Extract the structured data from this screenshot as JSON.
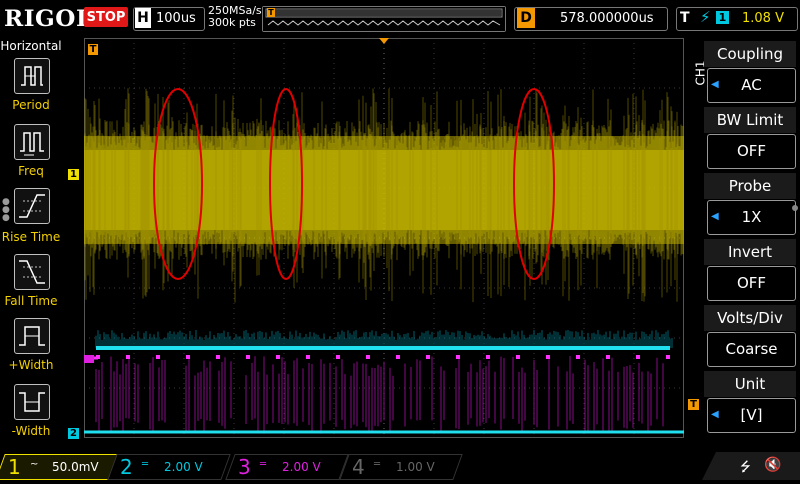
{
  "header": {
    "brand": "RIGOL",
    "run_state": "STOP",
    "horizontal_letter": "H",
    "timebase": "100us",
    "sample_rate": "250MSa/s",
    "memory_depth": "300k pts",
    "delay_letter": "D",
    "delay_value": "578.000000us",
    "trigger_letter": "T",
    "trigger_source": "1",
    "trigger_level": "1.08 V"
  },
  "left_menu": {
    "title": "Horizontal",
    "items": [
      {
        "label": "Period",
        "icon": "period-icon"
      },
      {
        "label": "Freq",
        "icon": "frequency-icon"
      },
      {
        "label": "Rise Time",
        "icon": "rise-time-icon"
      },
      {
        "label": "Fall Time",
        "icon": "fall-time-icon"
      },
      {
        "label": "+Width",
        "icon": "positive-width-icon"
      },
      {
        "label": "-Width",
        "icon": "negative-width-icon"
      }
    ]
  },
  "right_menu": {
    "channel": "CH1",
    "items": [
      {
        "title": "Coupling",
        "value": "AC",
        "has_arrow": true
      },
      {
        "title": "BW Limit",
        "value": "OFF",
        "has_arrow": false
      },
      {
        "title": "Probe",
        "value": "1X",
        "has_arrow": true
      },
      {
        "title": "Invert",
        "value": "OFF",
        "has_arrow": false
      },
      {
        "title": "Volts/Div",
        "value": "Coarse",
        "has_arrow": false
      },
      {
        "title": "Unit",
        "value": "[V]",
        "has_arrow": true
      }
    ]
  },
  "plot": {
    "markers": {
      "ch1_ref": "1",
      "ch2_ref": "2",
      "trigger_pos": "T",
      "trigger_level": "T"
    }
  },
  "channels": [
    {
      "num": "1",
      "coupling_symbol": "~",
      "scale": "50.0mV",
      "color": "#f0e000",
      "active": true
    },
    {
      "num": "2",
      "coupling_symbol": "═",
      "scale": "2.00 V",
      "color": "#00c8e0",
      "active": false
    },
    {
      "num": "3",
      "coupling_symbol": "═",
      "scale": "2.00 V",
      "color": "#e020e0",
      "active": false
    },
    {
      "num": "4",
      "coupling_symbol": "═",
      "scale": "1.00 V",
      "color": "#666666",
      "active": false
    }
  ],
  "status_icons": [
    "usb-icon",
    "speaker-muted-icon"
  ],
  "colors": {
    "ch1": "#f0e000",
    "ch2": "#00c8e0",
    "ch3": "#e020e0",
    "trigger": "#f39800",
    "run_state": "#e01818",
    "annotation": "#e00000"
  }
}
